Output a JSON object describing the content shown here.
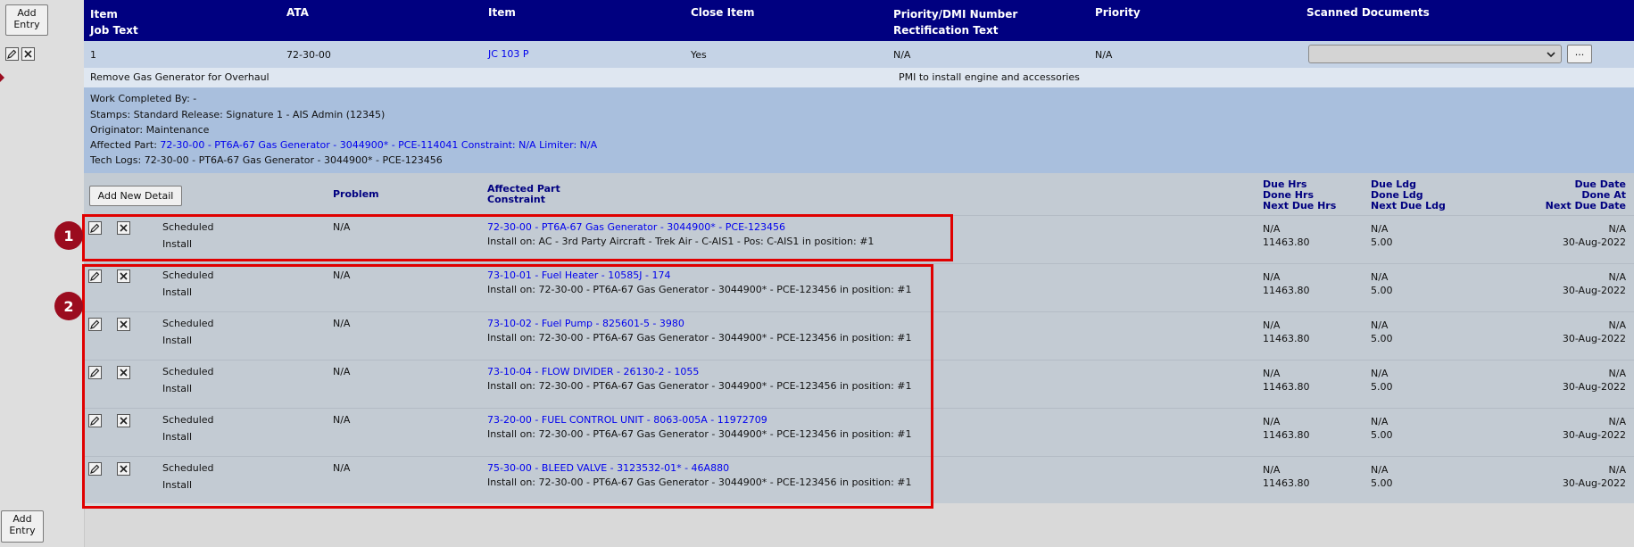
{
  "actions": {
    "add_entry_line1": "Add",
    "add_entry_line2": "Entry",
    "add_new_detail": "Add New Detail",
    "ellipsis": "..."
  },
  "header": {
    "item_line1": "Item",
    "item_line2": "Job Text",
    "ata": "ATA",
    "item2": "Item",
    "close_item": "Close Item",
    "priority_dmi_line1": "Priority/DMI Number",
    "priority_dmi_line2": "Rectification Text",
    "priority": "Priority",
    "scanned_documents": "Scanned Documents"
  },
  "entry": {
    "item": "1",
    "ata": "72-30-00",
    "item_link": "JC 103 P",
    "close_item": "Yes",
    "priority_dmi": "N/A",
    "priority": "N/A",
    "job_text": "Remove Gas Generator for Overhaul",
    "rectification_text": "PMI to install engine and accessories"
  },
  "info": {
    "work_completed": "Work Completed By: -",
    "stamps": "Stamps: Standard Release: Signature 1 - AIS Admin (12345)",
    "originator": "Originator: Maintenance",
    "affected_part_label": "Affected Part: ",
    "affected_part_link": "72-30-00 - PT6A-67 Gas Generator - 3044900* - PCE-114041 Constraint: N/A Limiter: N/A",
    "tech_logs": "Tech Logs: 72-30-00 - PT6A-67 Gas Generator - 3044900* - PCE-123456"
  },
  "detail_header": {
    "problem": "Problem",
    "affected_part_line1": "Affected Part",
    "affected_part_line2": "Constraint",
    "due_hrs_line1": "Due Hrs",
    "due_hrs_line2": "Done Hrs",
    "due_hrs_line3": "Next Due Hrs",
    "due_ldg_line1": "Due Ldg",
    "due_ldg_line2": "Done Ldg",
    "due_ldg_line3": "Next Due Ldg",
    "due_date_line1": "Due Date",
    "due_date_line2": "Done At",
    "due_date_line3": "Next Due Date"
  },
  "annotations": {
    "badge1": "1",
    "badge2": "2"
  },
  "details": [
    {
      "status": "Scheduled",
      "action": "Install",
      "problem": "N/A",
      "part": "72-30-00 - PT6A-67 Gas Generator - 3044900* - PCE-123456",
      "constraint": "Install on: AC - 3rd Party Aircraft - Trek Air - C-AIS1 - Pos: C-AIS1 in position: #1",
      "due_hrs": "N/A",
      "done_hrs": "11463.80",
      "due_ldg": "N/A",
      "done_ldg": "5.00",
      "due_date": "N/A",
      "done_at": "30-Aug-2022"
    },
    {
      "status": "Scheduled",
      "action": "Install",
      "problem": "N/A",
      "part": "73-10-01 - Fuel Heater - 10585J - 174",
      "constraint": "Install on: 72-30-00 - PT6A-67 Gas Generator - 3044900* - PCE-123456 in position: #1",
      "due_hrs": "N/A",
      "done_hrs": "11463.80",
      "due_ldg": "N/A",
      "done_ldg": "5.00",
      "due_date": "N/A",
      "done_at": "30-Aug-2022"
    },
    {
      "status": "Scheduled",
      "action": "Install",
      "problem": "N/A",
      "part": "73-10-02 - Fuel Pump - 825601-5 - 3980",
      "constraint": "Install on: 72-30-00 - PT6A-67 Gas Generator - 3044900* - PCE-123456 in position: #1",
      "due_hrs": "N/A",
      "done_hrs": "11463.80",
      "due_ldg": "N/A",
      "done_ldg": "5.00",
      "due_date": "N/A",
      "done_at": "30-Aug-2022"
    },
    {
      "status": "Scheduled",
      "action": "Install",
      "problem": "N/A",
      "part": "73-10-04 - FLOW DIVIDER - 26130-2 - 1055",
      "constraint": "Install on: 72-30-00 - PT6A-67 Gas Generator - 3044900* - PCE-123456 in position: #1",
      "due_hrs": "N/A",
      "done_hrs": "11463.80",
      "due_ldg": "N/A",
      "done_ldg": "5.00",
      "due_date": "N/A",
      "done_at": "30-Aug-2022"
    },
    {
      "status": "Scheduled",
      "action": "Install",
      "problem": "N/A",
      "part": "73-20-00 - FUEL CONTROL UNIT - 8063-005A - 11972709",
      "constraint": "Install on: 72-30-00 - PT6A-67 Gas Generator - 3044900* - PCE-123456 in position: #1",
      "due_hrs": "N/A",
      "done_hrs": "11463.80",
      "due_ldg": "N/A",
      "done_ldg": "5.00",
      "due_date": "N/A",
      "done_at": "30-Aug-2022"
    },
    {
      "status": "Scheduled",
      "action": "Install",
      "problem": "N/A",
      "part": "75-30-00 - BLEED VALVE - 3123532-01* - 46A880",
      "constraint": "Install on: 72-30-00 - PT6A-67 Gas Generator - 3044900* - PCE-123456 in position: #1",
      "due_hrs": "N/A",
      "done_hrs": "11463.80",
      "due_ldg": "N/A",
      "done_ldg": "5.00",
      "due_date": "N/A",
      "done_at": "30-Aug-2022"
    }
  ]
}
